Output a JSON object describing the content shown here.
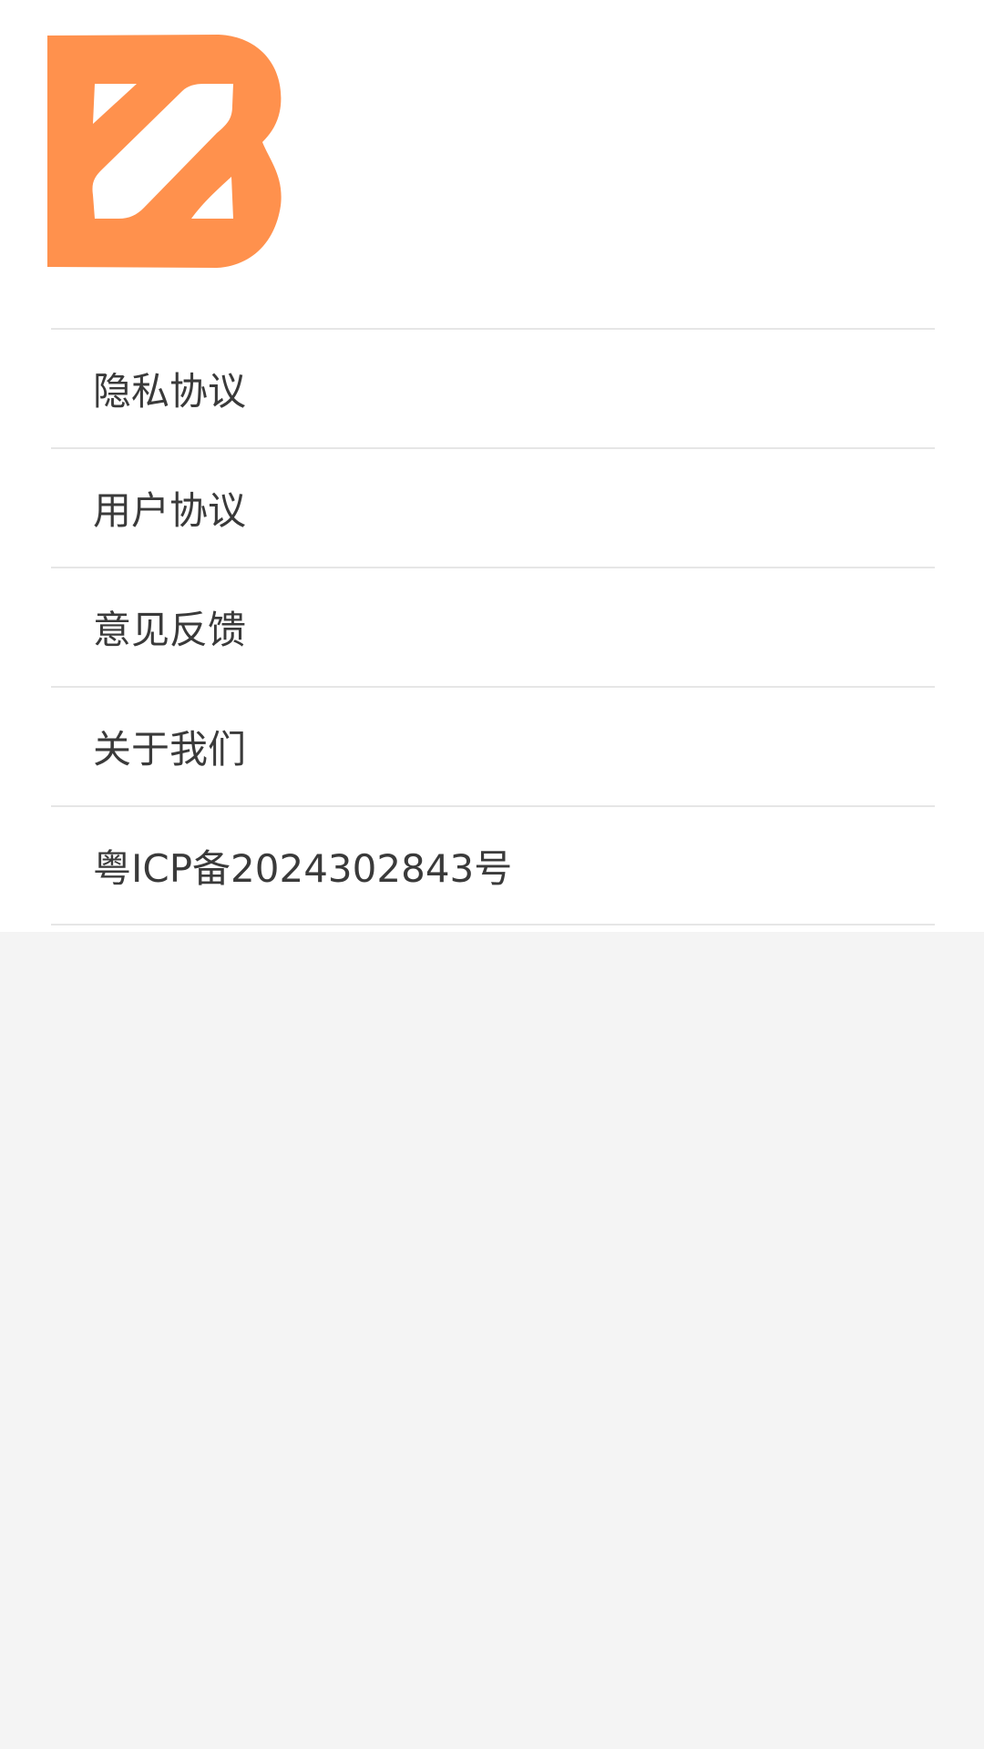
{
  "brand": {
    "logo_icon": "b-logo-icon",
    "accent_color": "#FF914D"
  },
  "menu": {
    "items": [
      {
        "label": "隐私协议"
      },
      {
        "label": "用户协议"
      },
      {
        "label": "意见反馈"
      },
      {
        "label": "关于我们"
      },
      {
        "label": "粤ICP备2024302843号"
      }
    ]
  }
}
